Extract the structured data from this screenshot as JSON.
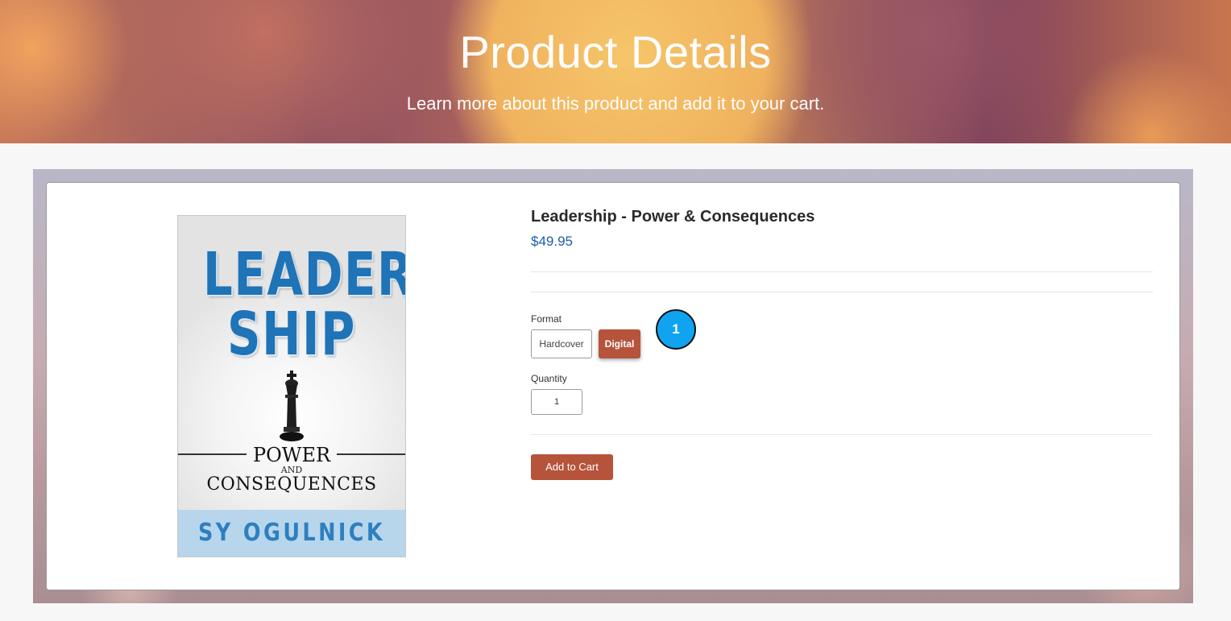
{
  "header": {
    "title": "Product Details",
    "subtitle": "Learn more about this product and add it to your cart."
  },
  "book_cover": {
    "title_line1": "LEADER",
    "title_line2": "SHIP",
    "subtitle_power": "POWER",
    "subtitle_and": "AND",
    "subtitle_consequences": "CONSEQUENCES",
    "author": "SY OGULNICK",
    "icon": "chess-king-icon"
  },
  "product": {
    "name": "Leadership - Power & Consequences",
    "price": "$49.95"
  },
  "format": {
    "label": "Format",
    "options": [
      {
        "label": "Hardcover",
        "selected": false
      },
      {
        "label": "Digital",
        "selected": true
      }
    ]
  },
  "annotation": {
    "marker_label": "1"
  },
  "quantity": {
    "label": "Quantity",
    "value": "1"
  },
  "cart": {
    "button_label": "Add to Cart"
  },
  "colors": {
    "accent": "#b6533b",
    "price": "#1a5ea8",
    "marker": "#0fa3f0"
  }
}
